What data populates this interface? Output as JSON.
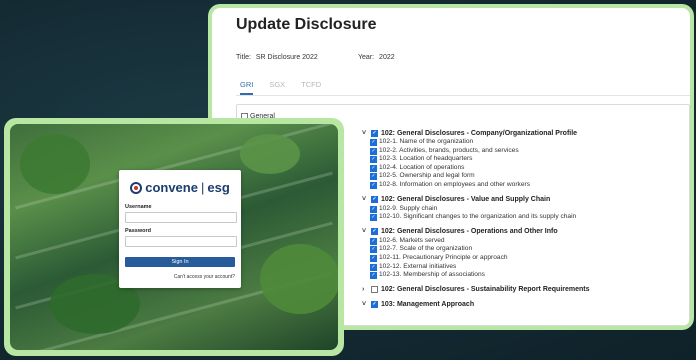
{
  "disclosure": {
    "title": "Update Disclosure",
    "title_label": "Title:",
    "title_value": "SR Disclosure 2022",
    "year_label": "Year:",
    "year_value": "2022",
    "tabs": [
      {
        "label": "GRI",
        "active": true
      },
      {
        "label": "SGX",
        "active": false
      },
      {
        "label": "TCFD",
        "active": false
      }
    ],
    "general_label": "General",
    "groups": [
      {
        "label": "102: General Disclosures - Company/Organizational Profile",
        "expanded": true,
        "checked": true,
        "items": [
          "102-1. Name of the organization",
          "102-2. Activities, brands, products, and services",
          "102-3. Location of headquarters",
          "102-4. Location of operations",
          "102-5. Ownership and legal form",
          "102-8. Information on employees and other workers"
        ]
      },
      {
        "label": "102: General Disclosures - Value and Supply Chain",
        "expanded": true,
        "checked": true,
        "items": [
          "102-9. Supply chain",
          "102-10. Significant changes to the organization and its supply chain"
        ]
      },
      {
        "label": "102: General Disclosures - Operations and Other Info",
        "expanded": true,
        "checked": true,
        "items": [
          "102-6. Markets served",
          "102-7. Scale of the organization",
          "102-11. Precautionary Principle or approach",
          "102-12. External initiatives",
          "102-13. Membership of associations"
        ]
      },
      {
        "label": "102: General Disclosures - Sustainability Report Requirements",
        "expanded": false,
        "checked": false,
        "items": []
      },
      {
        "label": "103: Management Approach",
        "expanded": true,
        "checked": true,
        "items": []
      }
    ]
  },
  "login": {
    "brand_left": "convene",
    "brand_sep": "|",
    "brand_right": "esg",
    "username_label": "Username",
    "password_label": "Password",
    "signin_label": "Sign In",
    "cant_access": "Can't access your account?"
  },
  "colors": {
    "accent": "#2e6fb4",
    "frame": "#b8e6a3",
    "checkbox": "#1d6fd8",
    "brand_navy": "#1c3d6e",
    "brand_red": "#d4302b"
  }
}
